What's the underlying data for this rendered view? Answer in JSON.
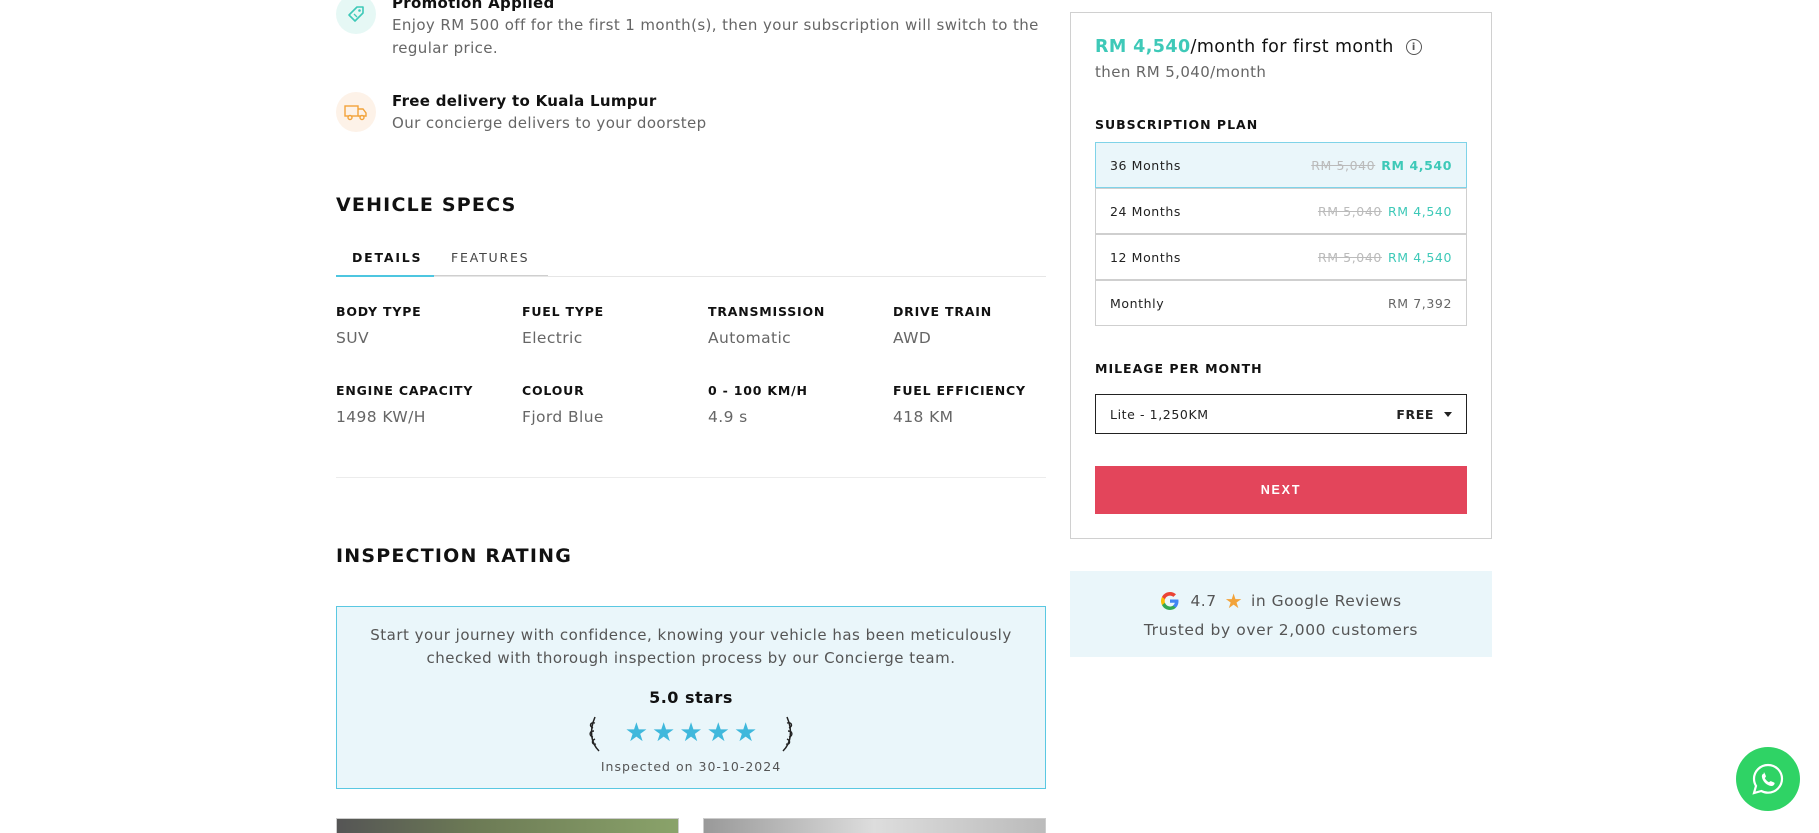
{
  "promotions": [
    {
      "title": "Promotion Applied",
      "desc_line1": "Enjoy RM 500 off for the first 1 month(s), then your subscription will switch to the",
      "desc_line2": "regular price.",
      "icon": "tag-icon",
      "color": "#3ec9b8"
    },
    {
      "title": "Free delivery to Kuala Lumpur",
      "desc_line1": "Our concierge delivers to your doorstep",
      "icon": "delivery-truck-icon",
      "color": "#f2a33a"
    }
  ],
  "vehicle_specs": {
    "title": "VEHICLE SPECS",
    "tabs": [
      {
        "label": "DETAILS",
        "active": true
      },
      {
        "label": "FEATURES",
        "active": false
      }
    ],
    "details": [
      {
        "label": "BODY TYPE",
        "value": "SUV"
      },
      {
        "label": "FUEL TYPE",
        "value": "Electric"
      },
      {
        "label": "TRANSMISSION",
        "value": "Automatic"
      },
      {
        "label": "DRIVE TRAIN",
        "value": "AWD"
      },
      {
        "label": "ENGINE CAPACITY",
        "value": "1498 KW/H"
      },
      {
        "label": "COLOUR",
        "value": "Fjord Blue"
      },
      {
        "label": "0 - 100 KM/H",
        "value": "4.9 s"
      },
      {
        "label": "FUEL EFFICIENCY",
        "value": "418 KM"
      }
    ]
  },
  "inspection": {
    "title": "INSPECTION RATING",
    "text_line1": "Start your journey with confidence, knowing your vehicle has been meticulously",
    "text_line2": "checked with thorough inspection process by our Concierge team.",
    "stars_label": "5.0 stars",
    "rating": 5,
    "date": "Inspected on 30-10-2024",
    "star_color": "#3fb8dc"
  },
  "pricing": {
    "price": "RM 4,540",
    "price_suffix": "/month for first month",
    "then": "then RM 5,040/month",
    "accent_color": "#3ec9b8"
  },
  "subscription_plan": {
    "label": "SUBSCRIPTION PLAN",
    "options": [
      {
        "name": "36 Months",
        "old": "RM 5,040",
        "new": "RM 4,540",
        "selected": true
      },
      {
        "name": "24 Months",
        "old": "RM 5,040",
        "new": "RM 4,540",
        "selected": false
      },
      {
        "name": "12 Months",
        "old": "RM 5,040",
        "new": "RM 4,540",
        "selected": false
      },
      {
        "name": "Monthly",
        "price": "RM 7,392",
        "selected": false
      }
    ]
  },
  "mileage": {
    "label": "MILEAGE PER MONTH",
    "selected": "Lite - 1,250KM",
    "price": "FREE"
  },
  "next_button": "NEXT",
  "next_color": "#e3455b",
  "reviews": {
    "rating": "4.7",
    "text": "in Google Reviews",
    "trusted": "Trusted by over 2,000 customers"
  },
  "whatsapp_color": "#2fd365"
}
